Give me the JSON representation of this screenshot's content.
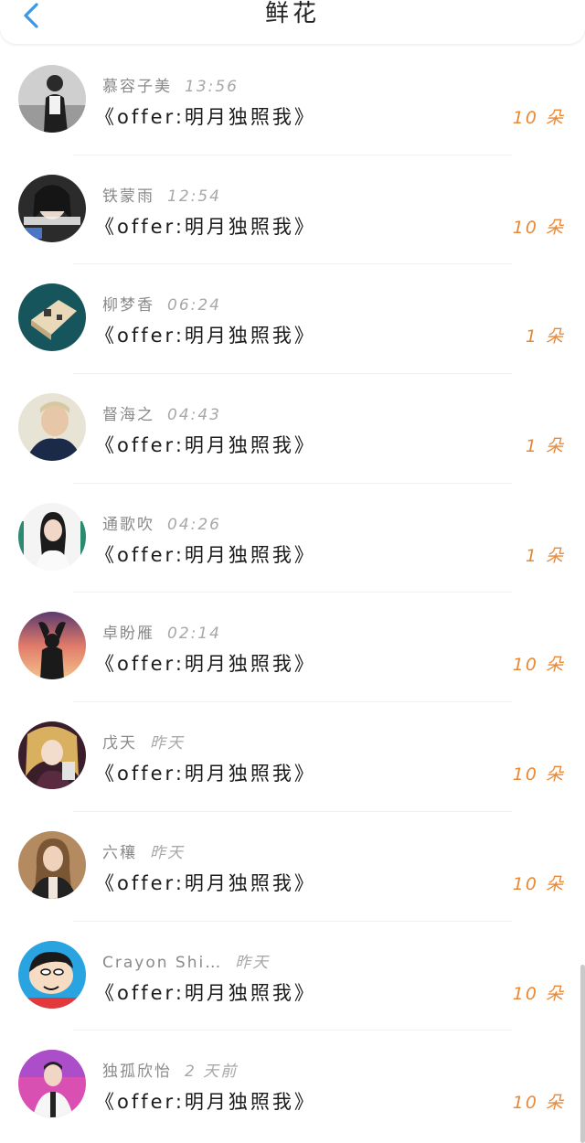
{
  "header": {
    "title": "鲜花"
  },
  "colors": {
    "accent": "#3a97e6",
    "count": "#e8893a",
    "name": "#8a8a8a"
  },
  "items": [
    {
      "name": "慕容子美",
      "time": "13:56",
      "book": "《offer:明月独照我》",
      "count": "10 朵"
    },
    {
      "name": "铁蒙雨",
      "time": "12:54",
      "book": "《offer:明月独照我》",
      "count": "10 朵"
    },
    {
      "name": "柳梦香",
      "time": "06:24",
      "book": "《offer:明月独照我》",
      "count": "1 朵"
    },
    {
      "name": "督海之",
      "time": "04:43",
      "book": "《offer:明月独照我》",
      "count": "1 朵"
    },
    {
      "name": "通歌吹",
      "time": "04:26",
      "book": "《offer:明月独照我》",
      "count": "1 朵"
    },
    {
      "name": "卓盼雁",
      "time": "02:14",
      "book": "《offer:明月独照我》",
      "count": "10 朵"
    },
    {
      "name": "戊天",
      "time": "昨天",
      "book": "《offer:明月独照我》",
      "count": "10 朵"
    },
    {
      "name": "六穰",
      "time": "昨天",
      "book": "《offer:明月独照我》",
      "count": "10 朵"
    },
    {
      "name": "Crayon Shi…",
      "time": "昨天",
      "book": "《offer:明月独照我》",
      "count": "10 朵"
    },
    {
      "name": "独孤欣怡",
      "time": "2 天前",
      "book": "《offer:明月独照我》",
      "count": "10 朵"
    }
  ]
}
